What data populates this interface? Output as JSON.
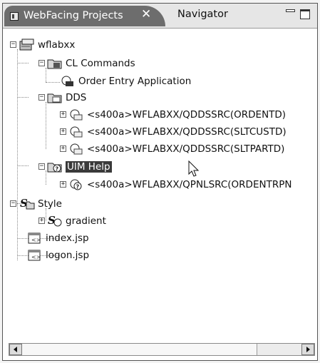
{
  "tabs": {
    "active": {
      "label": "WebFacing Projects",
      "close": "✕"
    },
    "inactive": {
      "label": "Navigator"
    }
  },
  "tree": {
    "root": "wflabxx",
    "cl_commands": "CL Commands",
    "order_entry": "Order Entry Application",
    "dds": "DDS",
    "dds_items": [
      "<s400a>WFLABXX/QDDSSRC(ORDENTD)",
      "<s400a>WFLABXX/QDDSSRC(SLTCUSTD)",
      "<s400a>WFLABXX/QDDSSRC(SLTPARTD)"
    ],
    "uim_help": "UIM Help",
    "uim_item": "<s400a>WFLABXX/QPNLSRC(ORDENTRPN",
    "style": "Style",
    "gradient": "gradient",
    "index": "index.jsp",
    "logon": "logon.jsp"
  },
  "icons": {
    "project": "project-icon",
    "folder": "folder-icon",
    "command": "command-icon",
    "dds_file": "dds-file-icon",
    "help": "help-icon",
    "style": "style-icon",
    "jsp": "jsp-file-icon"
  }
}
